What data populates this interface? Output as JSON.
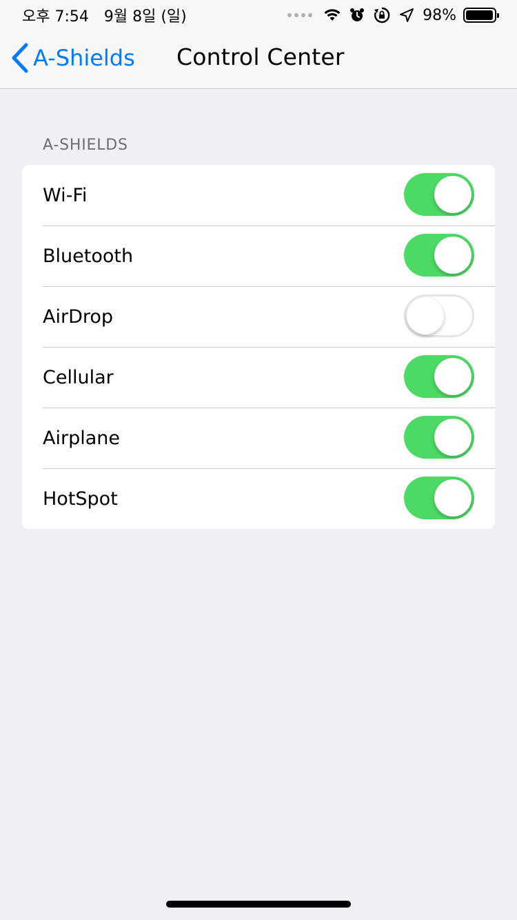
{
  "status_bar": {
    "ampm_time": "오후 7:54",
    "date": "9월 8일 (일)",
    "battery_percent": "98%",
    "battery_level": 0.98,
    "icons": [
      "signal-dots-icon",
      "wifi-icon",
      "alarm-icon",
      "rotation-lock-icon",
      "location-arrow-icon",
      "battery-icon"
    ]
  },
  "nav": {
    "back_label": "A-Shields",
    "title": "Control Center"
  },
  "section": {
    "header": "A-SHIELDS",
    "rows": [
      {
        "label": "Wi-Fi",
        "on": true
      },
      {
        "label": "Bluetooth",
        "on": true
      },
      {
        "label": "AirDrop",
        "on": false
      },
      {
        "label": "Cellular",
        "on": true
      },
      {
        "label": "Airplane",
        "on": true
      },
      {
        "label": "HotSpot",
        "on": true
      }
    ]
  },
  "colors": {
    "accent": "#007aff",
    "toggle_on": "#4cd964",
    "background": "#efeff4"
  }
}
